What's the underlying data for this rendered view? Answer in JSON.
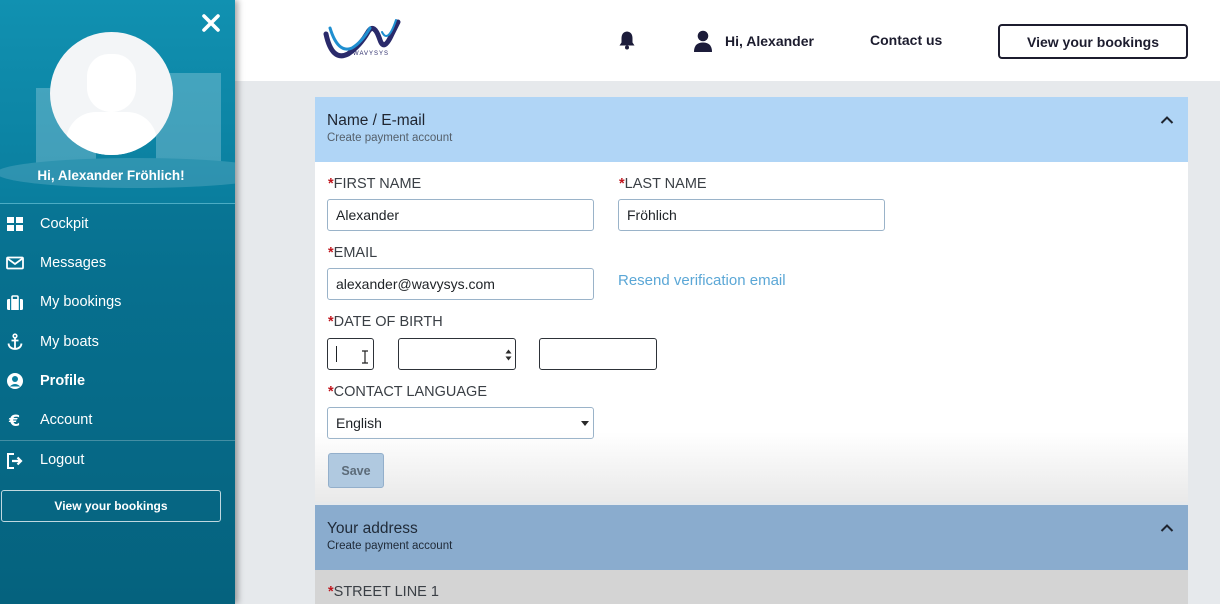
{
  "sidebar": {
    "greeting": "Hi, Alexander Fröhlich!",
    "items": [
      {
        "label": "Cockpit",
        "icon": "grid-icon"
      },
      {
        "label": "Messages",
        "icon": "envelope-icon"
      },
      {
        "label": "My bookings",
        "icon": "briefcase-icon"
      },
      {
        "label": "My boats",
        "icon": "anchor-icon"
      },
      {
        "label": "Profile",
        "icon": "user-circle-icon",
        "active": true
      },
      {
        "label": "Account",
        "icon": "euro-icon"
      },
      {
        "label": "Logout",
        "icon": "logout-icon"
      }
    ],
    "bookings_button": "View your bookings"
  },
  "header": {
    "logo_text": "WAVYSYS",
    "user_greeting": "Hi, Alexander",
    "contact": "Contact us",
    "bookings_button": "View your bookings"
  },
  "name_section": {
    "title": "Name / E-mail",
    "subtitle": "Create payment account",
    "required_mark": "*",
    "first_name_label": "FIRST NAME",
    "first_name_value": "Alexander",
    "last_name_label": "LAST NAME",
    "last_name_value": "Fröhlich",
    "email_label": "EMAIL",
    "email_value": "alexander@wavysys.com",
    "resend": "Resend verification email",
    "dob_label": "DATE OF BIRTH",
    "language_label": "CONTACT LANGUAGE",
    "language_value": "English",
    "save": "Save"
  },
  "address_section": {
    "title": "Your address",
    "subtitle": "Create payment account",
    "street_label": "STREET LINE 1"
  },
  "colors": {
    "sidebar": "#0a7e9e",
    "section_header": "#b0d5f6",
    "address_header": "#8aacce",
    "required": "#c0161e",
    "link": "#5ba7d6"
  }
}
